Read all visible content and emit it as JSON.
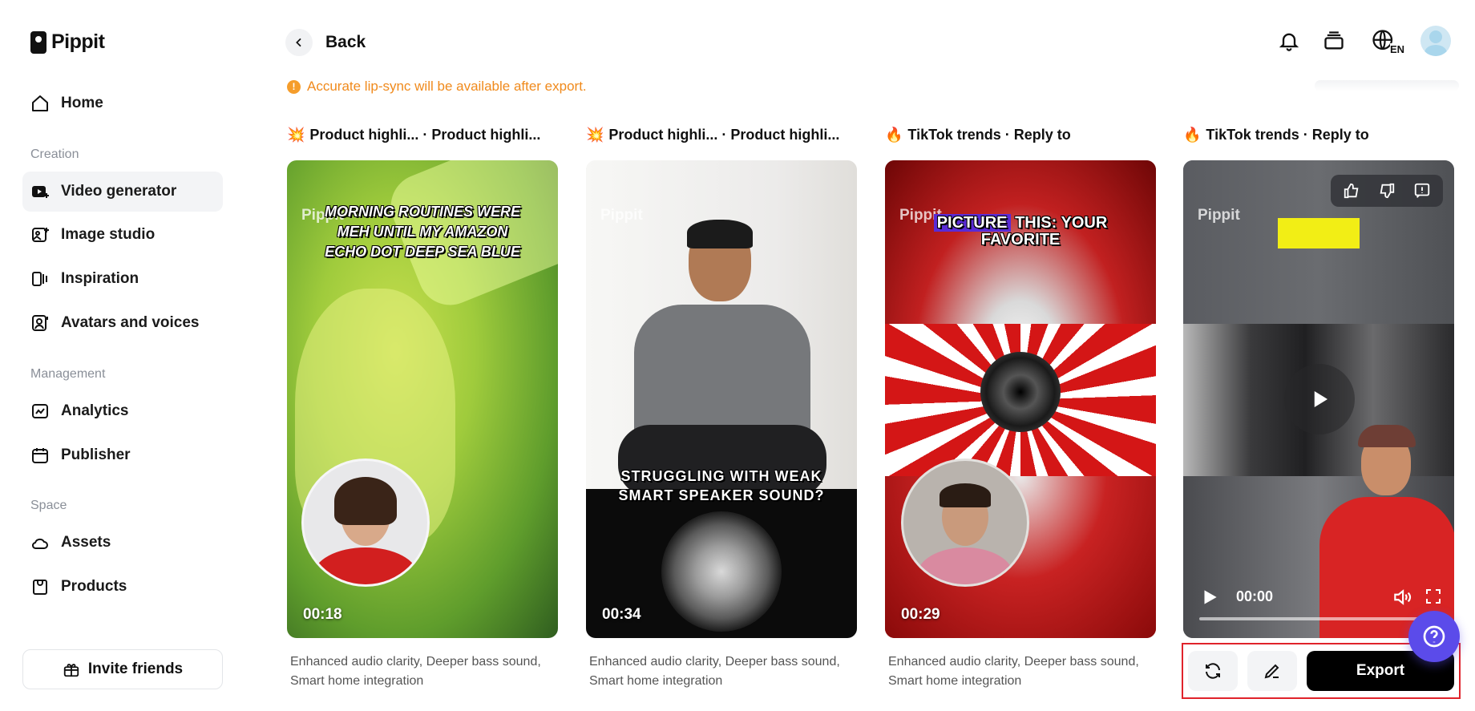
{
  "app": {
    "name": "Pippit"
  },
  "sidebar": {
    "home": "Home",
    "sections": {
      "creation": "Creation",
      "management": "Management",
      "space": "Space"
    },
    "items": {
      "video_generator": "Video generator",
      "image_studio": "Image studio",
      "inspiration": "Inspiration",
      "avatars_voices": "Avatars and voices",
      "analytics": "Analytics",
      "publisher": "Publisher",
      "assets": "Assets",
      "products": "Products"
    },
    "invite": "Invite friends",
    "active_item": "Video generator"
  },
  "header": {
    "back_label": "Back",
    "language_code": "EN",
    "icons": [
      "bell-icon",
      "layers-icon",
      "globe-icon",
      "avatar"
    ]
  },
  "notice": {
    "text": "Accurate lip-sync will be available after export.",
    "color": "#f08a1c"
  },
  "cards": [
    {
      "emoji": "💥",
      "title": "Product highli...  · Product highli...",
      "watermark": "Pippit",
      "caption": "MORNING ROUTINES WERE MEH UNTIL MY AMAZON ECHO DOT DEEP SEA BLUE",
      "duration": "00:18",
      "description": "Enhanced audio clarity, Deeper bass sound, Smart home integration"
    },
    {
      "emoji": "💥",
      "title": "Product highli...  · Product highli...",
      "watermark": "Pippit",
      "caption": "STRUGGLING WITH WEAK SMART SPEAKER SOUND?",
      "duration": "00:34",
      "description": "Enhanced audio clarity, Deeper bass sound, Smart home integration"
    },
    {
      "emoji": "🔥",
      "title": "TikTok trends · Reply to",
      "watermark": "Pippit",
      "caption_highlight": "PICTURE",
      "caption_rest": "THIS: YOUR FAVORITE",
      "duration": "00:29",
      "description": "Enhanced audio clarity, Deeper bass sound, Smart home integration"
    },
    {
      "emoji": "🔥",
      "title": "TikTok trends · Reply to",
      "watermark": "Pippit",
      "player_time": "00:00",
      "feedback_icons": [
        "thumbs-up-icon",
        "thumbs-down-icon",
        "report-icon"
      ]
    }
  ],
  "actions": {
    "export_label": "Export",
    "regenerate_icon": "refresh-icon",
    "edit_icon": "pencil-icon"
  },
  "colors": {
    "accent": "#5b4bea",
    "highlight_border": "#e0232b",
    "export_bg": "#000000"
  }
}
